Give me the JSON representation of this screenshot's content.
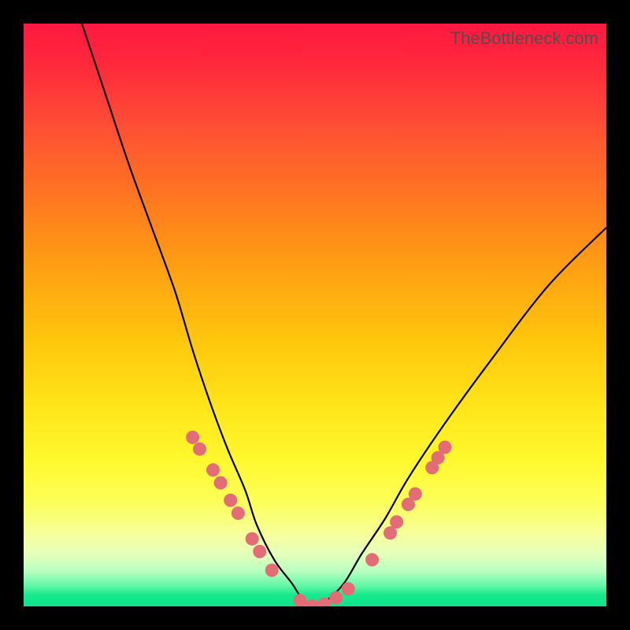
{
  "watermark": "TheBottleneck.com",
  "chart_data": {
    "type": "line",
    "title": "",
    "xlabel": "",
    "ylabel": "",
    "xlim": [
      0,
      100
    ],
    "ylim": [
      0,
      100
    ],
    "series": [
      {
        "name": "curve",
        "x": [
          10,
          14,
          18,
          22,
          26,
          29,
          32,
          35,
          38,
          40,
          43,
          46,
          48,
          50,
          52,
          55,
          58,
          62,
          66,
          72,
          80,
          90,
          100
        ],
        "values": [
          100,
          88,
          76,
          65,
          54,
          44,
          35,
          27,
          20,
          14,
          8,
          4,
          1,
          0,
          1,
          4,
          9,
          15,
          22,
          31,
          42,
          55,
          65
        ]
      }
    ],
    "points": [
      {
        "x": 29.0,
        "y": 29.0
      },
      {
        "x": 30.2,
        "y": 27.0
      },
      {
        "x": 32.5,
        "y": 23.4
      },
      {
        "x": 33.8,
        "y": 21.2
      },
      {
        "x": 35.5,
        "y": 18.2
      },
      {
        "x": 36.8,
        "y": 16.0
      },
      {
        "x": 39.2,
        "y": 11.6
      },
      {
        "x": 40.5,
        "y": 9.4
      },
      {
        "x": 42.6,
        "y": 6.2
      },
      {
        "x": 47.4,
        "y": 1.0
      },
      {
        "x": 49.5,
        "y": 0.1
      },
      {
        "x": 51.6,
        "y": 0.4
      },
      {
        "x": 53.6,
        "y": 1.5
      },
      {
        "x": 55.7,
        "y": 3.0
      },
      {
        "x": 59.8,
        "y": 8.0
      },
      {
        "x": 62.9,
        "y": 12.6
      },
      {
        "x": 64.0,
        "y": 14.5
      },
      {
        "x": 66.0,
        "y": 17.5
      },
      {
        "x": 67.2,
        "y": 19.3
      },
      {
        "x": 70.1,
        "y": 23.8
      },
      {
        "x": 71.1,
        "y": 25.5
      },
      {
        "x": 72.3,
        "y": 27.3
      }
    ],
    "point_color": "#e46c76",
    "curve_color": "#000000"
  }
}
